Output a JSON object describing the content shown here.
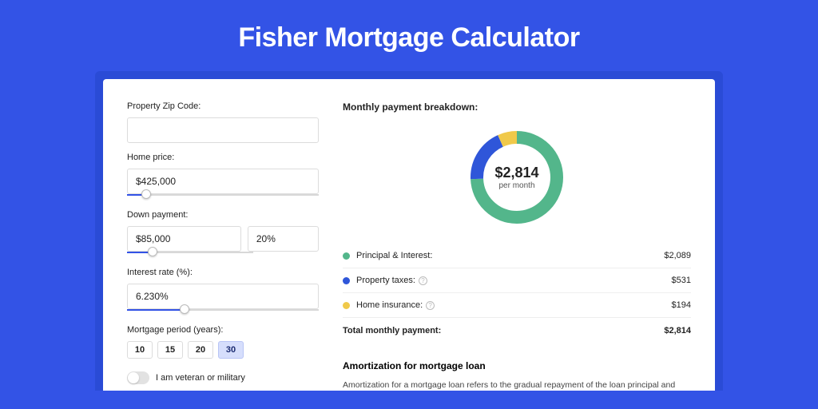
{
  "title": "Fisher Mortgage Calculator",
  "form": {
    "zip": {
      "label": "Property Zip Code:",
      "value": ""
    },
    "home_price": {
      "label": "Home price:",
      "value": "$425,000",
      "slider_pct": 10
    },
    "down_payment": {
      "label": "Down payment:",
      "amount": "$85,000",
      "pct": "20%",
      "slider_pct": 20
    },
    "interest": {
      "label": "Interest rate (%):",
      "value": "6.230%",
      "slider_pct": 30
    },
    "period": {
      "label": "Mortgage period (years):",
      "options": [
        "10",
        "15",
        "20",
        "30"
      ],
      "active": "30"
    },
    "veteran": {
      "label": "I am veteran or military",
      "on": false
    }
  },
  "breakdown": {
    "heading": "Monthly payment breakdown:",
    "center_amount": "$2,814",
    "center_sub": "per month",
    "rows": [
      {
        "color": "#53b68b",
        "label": "Principal & Interest:",
        "value": "$2,089",
        "info": false
      },
      {
        "color": "#2f56d9",
        "label": "Property taxes:",
        "value": "$531",
        "info": true
      },
      {
        "color": "#f0c94a",
        "label": "Home insurance:",
        "value": "$194",
        "info": true
      }
    ],
    "total": {
      "label": "Total monthly payment:",
      "value": "$2,814"
    }
  },
  "amort": {
    "heading": "Amortization for mortgage loan",
    "body": "Amortization for a mortgage loan refers to the gradual repayment of the loan principal and interest over a specified"
  },
  "chart_data": {
    "type": "pie",
    "title": "Monthly payment breakdown",
    "series": [
      {
        "name": "Principal & Interest",
        "value": 2089,
        "color": "#53b68b"
      },
      {
        "name": "Property taxes",
        "value": 531,
        "color": "#2f56d9"
      },
      {
        "name": "Home insurance",
        "value": 194,
        "color": "#f0c94a"
      }
    ],
    "total": 2814,
    "unit": "USD per month"
  }
}
